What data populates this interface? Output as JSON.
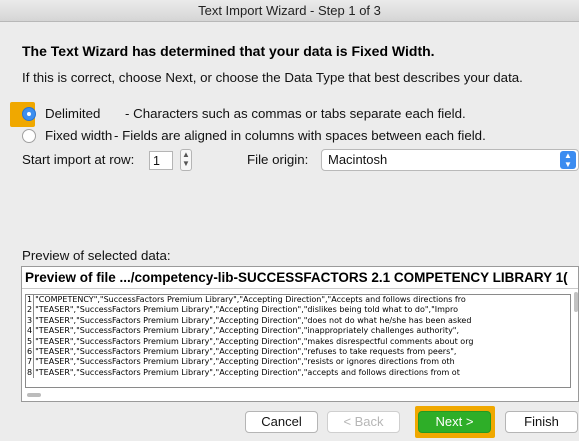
{
  "window": {
    "title": "Text Import Wizard - Step 1 of 3"
  },
  "intro": {
    "headline": "The Text Wizard has determined that your data is Fixed Width.",
    "subline": "If this is correct, choose Next, or choose the Data Type that best describes your data."
  },
  "data_type": {
    "options": [
      {
        "label": "Delimited",
        "description": "- Characters such as commas or tabs separate each field.",
        "selected": true
      },
      {
        "label": "Fixed width",
        "description": "- Fields are aligned in columns with spaces between each field.",
        "selected": false
      }
    ],
    "highlight_color": "#f0a800"
  },
  "import_settings": {
    "start_row_label": "Start import at row:",
    "start_row_value": "1",
    "file_origin_label": "File origin:",
    "file_origin_value": "Macintosh"
  },
  "preview": {
    "label": "Preview of selected data:",
    "title": "Preview of file .../competency-lib-SUCCESSFACTORS 2.1 COMPETENCY LIBRARY 1(",
    "lines": [
      {
        "num": "1",
        "text": "\"COMPETENCY\",\"SuccessFactors Premium Library\",\"Accepting Direction\",\"Accepts and follows directions fro"
      },
      {
        "num": "2",
        "text": "\"TEASER\",\"SuccessFactors Premium Library\",\"Accepting Direction\",\"dislikes being told what to do\",\"Impro"
      },
      {
        "num": "3",
        "text": "\"TEASER\",\"SuccessFactors Premium Library\",\"Accepting Direction\",\"does not do what he/she has been asked"
      },
      {
        "num": "4",
        "text": "\"TEASER\",\"SuccessFactors Premium Library\",\"Accepting Direction\",\"inappropriately challenges authority\","
      },
      {
        "num": "5",
        "text": "\"TEASER\",\"SuccessFactors Premium Library\",\"Accepting Direction\",\"makes disrespectful comments about org"
      },
      {
        "num": "6",
        "text": "\"TEASER\",\"SuccessFactors Premium Library\",\"Accepting Direction\",\"refuses to take requests from peers\","
      },
      {
        "num": "7",
        "text": "\"TEASER\",\"SuccessFactors Premium Library\",\"Accepting Direction\",\"resists or ignores directions from oth"
      },
      {
        "num": "8",
        "text": "\"TEASER\",\"SuccessFactors Premium Library\",\"Accepting Direction\",\"accepts and follows directions from ot"
      }
    ]
  },
  "buttons": {
    "cancel": "Cancel",
    "back": "< Back",
    "next": "Next >",
    "finish": "Finish",
    "next_color": "#2eae28",
    "next_highlight_color": "#f0a800"
  }
}
